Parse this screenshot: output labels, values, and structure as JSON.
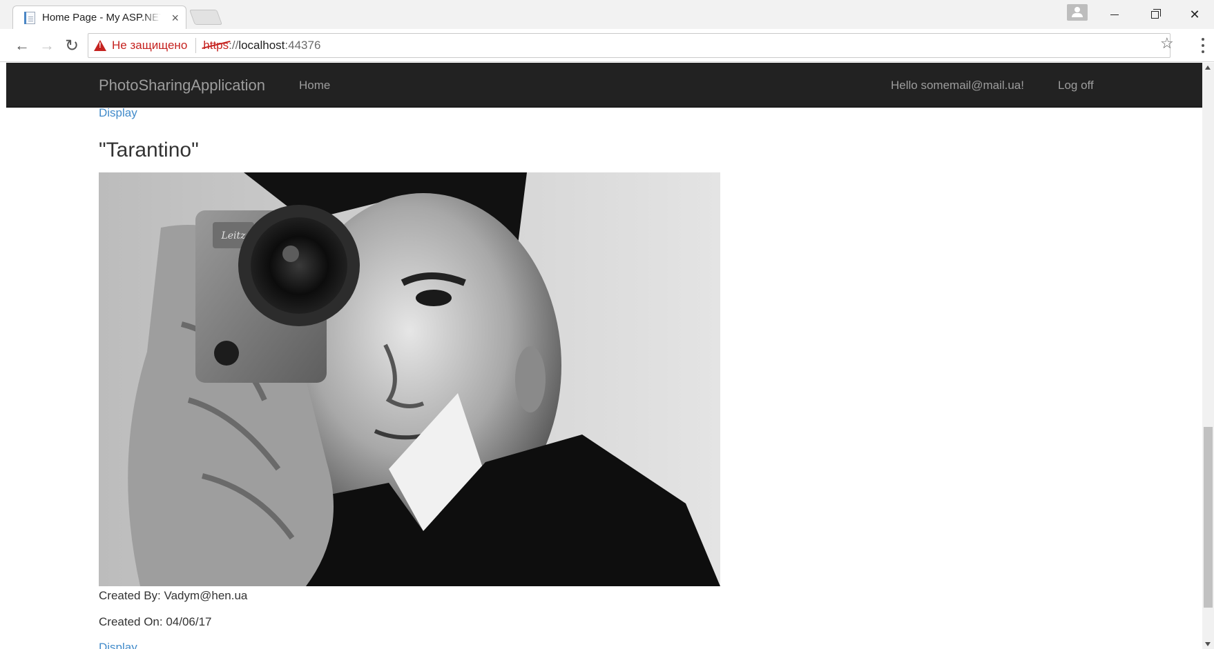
{
  "browser": {
    "tab_title": "Home Page - My ASP.NET Application",
    "tab_close": "×",
    "security_label": "Не защищено",
    "url_scheme": "https",
    "url_scheme_sep": "://",
    "url_host": "localhost",
    "url_port": ":44376"
  },
  "navbar": {
    "brand": "PhotoSharingApplication",
    "home": "Home",
    "greeting": "Hello somemail@mail.ua!",
    "logoff": "Log off"
  },
  "content": {
    "display_top": "Display",
    "photo_title": "\"Tarantino\"",
    "created_by": "Created By: Vadym@hen.ua",
    "created_on": "Created On: 04/06/17",
    "display_bottom": "Display"
  },
  "icons": {
    "back": "←",
    "forward": "→",
    "reload": "↻",
    "star": "☆",
    "close": "✕"
  },
  "colors": {
    "navbar_bg": "#222222",
    "navbar_text": "#9d9d9d",
    "link": "#428bca",
    "warning": "#c5221f"
  }
}
